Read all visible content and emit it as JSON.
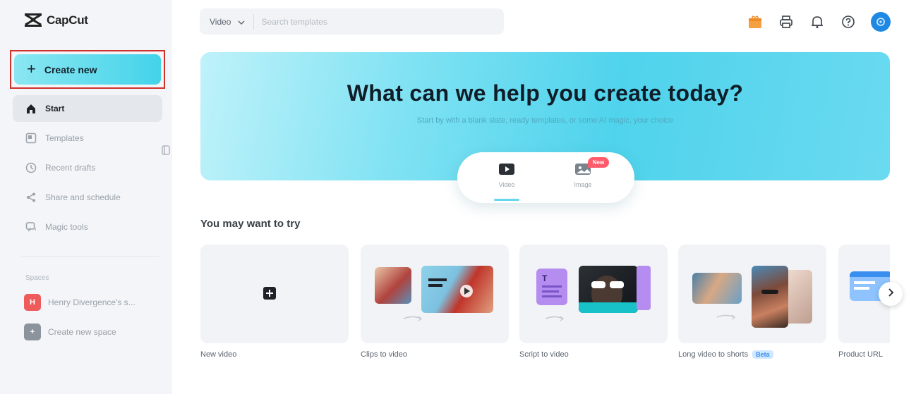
{
  "app": {
    "logo_text": "CapCut"
  },
  "sidebar": {
    "create_label": "Create new",
    "items": [
      {
        "label": "Start",
        "icon": "home-icon",
        "active": true
      },
      {
        "label": "Templates",
        "icon": "templates-icon",
        "active": false
      },
      {
        "label": "Recent drafts",
        "icon": "clock-icon",
        "active": false
      },
      {
        "label": "Share and schedule",
        "icon": "share-icon",
        "active": false
      },
      {
        "label": "Magic tools",
        "icon": "magic-icon",
        "active": false
      }
    ],
    "spaces_label": "Spaces",
    "spaces": [
      {
        "label": "Henry Divergence's s...",
        "initial": "H",
        "color": "#ef5a5a"
      },
      {
        "label": "Create new space",
        "initial": "+",
        "color": "#8c939c"
      }
    ]
  },
  "header": {
    "type_select": "Video",
    "search_placeholder": "Search templates",
    "icons": [
      "gift-icon",
      "printer-icon",
      "bell-icon",
      "help-icon",
      "avatar"
    ],
    "brand_colors": {
      "gift": "#f5a040",
      "avatar": "#1e88e5",
      "accent": "#43d3ea"
    }
  },
  "hero": {
    "title": "What can we help you create today?",
    "subtitle": "Start by with a blank slate, ready templates, or some AI magic, your choice",
    "tabs": [
      {
        "label": "Video",
        "icon": "video-icon",
        "active": true
      },
      {
        "label": "Image",
        "icon": "image-icon",
        "active": false,
        "badge": "New"
      }
    ]
  },
  "try_section": {
    "title": "You may want to try",
    "cards": [
      {
        "label": "New video",
        "icon": "add-icon"
      },
      {
        "label": "Clips to video"
      },
      {
        "label": "Script to video"
      },
      {
        "label": "Long video to shorts",
        "badge": "Beta"
      },
      {
        "label": "Product URL"
      }
    ]
  }
}
